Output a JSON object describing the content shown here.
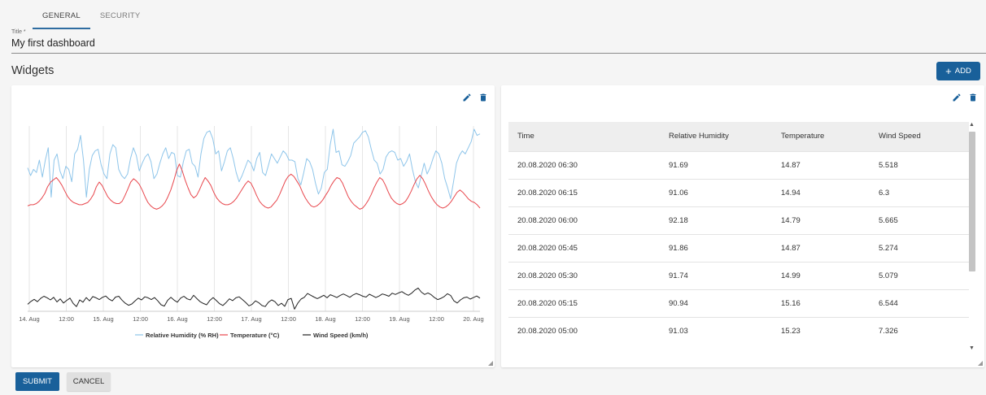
{
  "tabs": [
    {
      "label": "GENERAL",
      "active": true
    },
    {
      "label": "SECURITY",
      "active": false
    }
  ],
  "title_field": {
    "label": "Title *",
    "value": "My first dashboard"
  },
  "widgets": {
    "heading": "Widgets",
    "add_label": "ADD"
  },
  "icons": {
    "add": "plus-icon",
    "edit": "pencil-icon",
    "delete": "trash-icon",
    "resize": "resize-handle-icon",
    "scroll_up": "chevron-up-icon",
    "scroll_down": "chevron-down-icon"
  },
  "colors": {
    "primary": "#19609a",
    "humidity": "#8ec5ea",
    "temperature": "#e8474d",
    "wind": "#222222"
  },
  "chart_data": {
    "type": "line",
    "x_ticks": [
      "14. Aug",
      "12:00",
      "15. Aug",
      "12:00",
      "16. Aug",
      "12:00",
      "17. Aug",
      "12:00",
      "18. Aug",
      "12:00",
      "19. Aug",
      "12:00",
      "20. Aug"
    ],
    "grid": "vertical",
    "legend_position": "bottom",
    "series": [
      {
        "name": "Relative Humidity (% RH)",
        "color": "#8ec5ea",
        "values": [
          75,
          70,
          74,
          72,
          80,
          69,
          80,
          88,
          56,
          80,
          84,
          73,
          68,
          76,
          74,
          66,
          84,
          87,
          96,
          80,
          56,
          74,
          83,
          86,
          87,
          77,
          71,
          68,
          84,
          90,
          88,
          74,
          70,
          68,
          71,
          81,
          88,
          83,
          73,
          78,
          82,
          84,
          79,
          68,
          71,
          78,
          84,
          88,
          81,
          85,
          84,
          70,
          69,
          79,
          86,
          87,
          78,
          76,
          69,
          84,
          94,
          98,
          99,
          94,
          84,
          86,
          73,
          79,
          86,
          88,
          81,
          72,
          66,
          70,
          75,
          80,
          78,
          73,
          81,
          85,
          72,
          70,
          77,
          84,
          81,
          78,
          82,
          86,
          84,
          80,
          80,
          79,
          68,
          64,
          72,
          81,
          79,
          74,
          65,
          58,
          62,
          72,
          74,
          90,
          100,
          85,
          86,
          77,
          76,
          79,
          83,
          91,
          93,
          95,
          98,
          99,
          95,
          87,
          80,
          78,
          71,
          74,
          82,
          85,
          86,
          85,
          80,
          81,
          76,
          79,
          84,
          74,
          66,
          62,
          70,
          78,
          71,
          75,
          81,
          86,
          84,
          78,
          68,
          62,
          55,
          66,
          78,
          83,
          86,
          84,
          88,
          92,
          100,
          96,
          97
        ]
      },
      {
        "name": "Temperature (°C)",
        "color": "#e8474d",
        "values": [
          14.5,
          14.6,
          14.6,
          14.7,
          14.9,
          15.2,
          15.6,
          16.2,
          16.6,
          16.8,
          17.0,
          16.7,
          16.3,
          15.8,
          15.3,
          15.0,
          14.8,
          14.7,
          14.6,
          14.6,
          14.7,
          14.8,
          15.1,
          15.5,
          16.2,
          16.6,
          16.3,
          15.8,
          15.3,
          15.0,
          14.8,
          14.7,
          14.7,
          14.9,
          15.4,
          16.0,
          16.6,
          16.9,
          16.7,
          16.4,
          15.9,
          15.3,
          14.8,
          14.5,
          14.3,
          14.2,
          14.3,
          14.5,
          14.8,
          15.3,
          15.9,
          16.7,
          17.6,
          18.2,
          17.6,
          16.8,
          16.1,
          15.5,
          15.2,
          15.4,
          15.9,
          16.5,
          17.0,
          16.7,
          16.3,
          15.7,
          15.2,
          14.9,
          14.7,
          14.6,
          14.6,
          14.7,
          14.9,
          15.2,
          15.6,
          16.0,
          16.4,
          16.7,
          16.5,
          16.0,
          15.4,
          14.9,
          14.6,
          14.4,
          14.3,
          14.4,
          14.7,
          15.0,
          15.5,
          16.1,
          16.7,
          17.1,
          17.3,
          17.1,
          16.7,
          16.3,
          15.7,
          15.2,
          14.8,
          14.5,
          14.4,
          14.5,
          14.7,
          15.0,
          15.4,
          15.8,
          16.3,
          16.7,
          17.0,
          16.9,
          16.5,
          15.9,
          15.3,
          14.9,
          14.6,
          14.4,
          14.2,
          14.3,
          14.6,
          15.0,
          15.5,
          16.1,
          16.6,
          17.0,
          16.8,
          16.3,
          15.7,
          15.2,
          14.9,
          14.7,
          14.6,
          14.7,
          14.9,
          15.3,
          15.8,
          16.4,
          16.9,
          17.2,
          16.9,
          16.4,
          15.8,
          15.3,
          14.9,
          14.6,
          14.4,
          14.3,
          14.4,
          14.6,
          14.9,
          15.3,
          15.7,
          15.9,
          15.7,
          15.4,
          15.1,
          14.9,
          14.8,
          14.6,
          14.3
        ]
      },
      {
        "name": "Wind Speed (km/h)",
        "color": "#222222",
        "values": [
          2.1,
          3.2,
          4.0,
          3.1,
          4.4,
          5.2,
          4.6,
          3.8,
          4.8,
          3.0,
          4.2,
          2.6,
          3.6,
          4.5,
          2.4,
          1.2,
          3.8,
          2.9,
          4.7,
          3.4,
          5.1,
          4.6,
          3.9,
          4.8,
          5.3,
          4.1,
          3.4,
          4.9,
          5.2,
          3.7,
          2.5,
          1.7,
          2.2,
          3.4,
          4.5,
          3.8,
          5.0,
          4.6,
          3.9,
          4.7,
          3.4,
          1.9,
          1.4,
          3.6,
          4.8,
          3.7,
          2.9,
          4.5,
          5.2,
          4.2,
          3.8,
          5.6,
          4.3,
          3.1,
          2.4,
          1.9,
          3.6,
          4.7,
          3.5,
          2.3,
          1.6,
          2.8,
          4.2,
          3.5,
          4.6,
          5.0,
          3.9,
          2.8,
          1.5,
          2.1,
          3.4,
          2.7,
          1.6,
          1.2,
          2.9,
          3.8,
          3.1,
          1.6,
          2.5,
          1.3,
          3.9,
          4.4,
          0.2,
          2.5,
          4.1,
          4.8,
          6.3,
          5.6,
          4.9,
          4.3,
          4.9,
          5.6,
          4.6,
          5.8,
          5.3,
          4.7,
          5.5,
          6.1,
          5.5,
          4.8,
          5.7,
          6.3,
          5.8,
          5.2,
          4.9,
          6.0,
          5.4,
          4.7,
          5.3,
          6.1,
          5.7,
          5.2,
          6.4,
          5.9,
          6.5,
          7.0,
          6.2,
          5.6,
          6.4,
          7.6,
          8.4,
          6.8,
          5.9,
          6.5,
          5.8,
          4.7,
          3.9,
          4.4,
          5.1,
          6.2,
          5.5,
          3.4,
          2.6,
          3.8,
          4.6,
          4.9,
          4.1,
          4.7,
          5.3,
          4.5
        ]
      }
    ]
  },
  "table": {
    "columns": [
      "Time",
      "Relative Humidity",
      "Temperature",
      "Wind Speed"
    ],
    "rows": [
      [
        "20.08.2020 06:30",
        "91.69",
        "14.87",
        "5.518"
      ],
      [
        "20.08.2020 06:15",
        "91.06",
        "14.94",
        "6.3"
      ],
      [
        "20.08.2020 06:00",
        "92.18",
        "14.79",
        "5.665"
      ],
      [
        "20.08.2020 05:45",
        "91.86",
        "14.87",
        "5.274"
      ],
      [
        "20.08.2020 05:30",
        "91.74",
        "14.99",
        "5.079"
      ],
      [
        "20.08.2020 05:15",
        "90.94",
        "15.16",
        "6.544"
      ],
      [
        "20.08.2020 05:00",
        "91.03",
        "15.23",
        "7.326"
      ]
    ]
  },
  "buttons": {
    "submit": "SUBMIT",
    "cancel": "CANCEL"
  }
}
